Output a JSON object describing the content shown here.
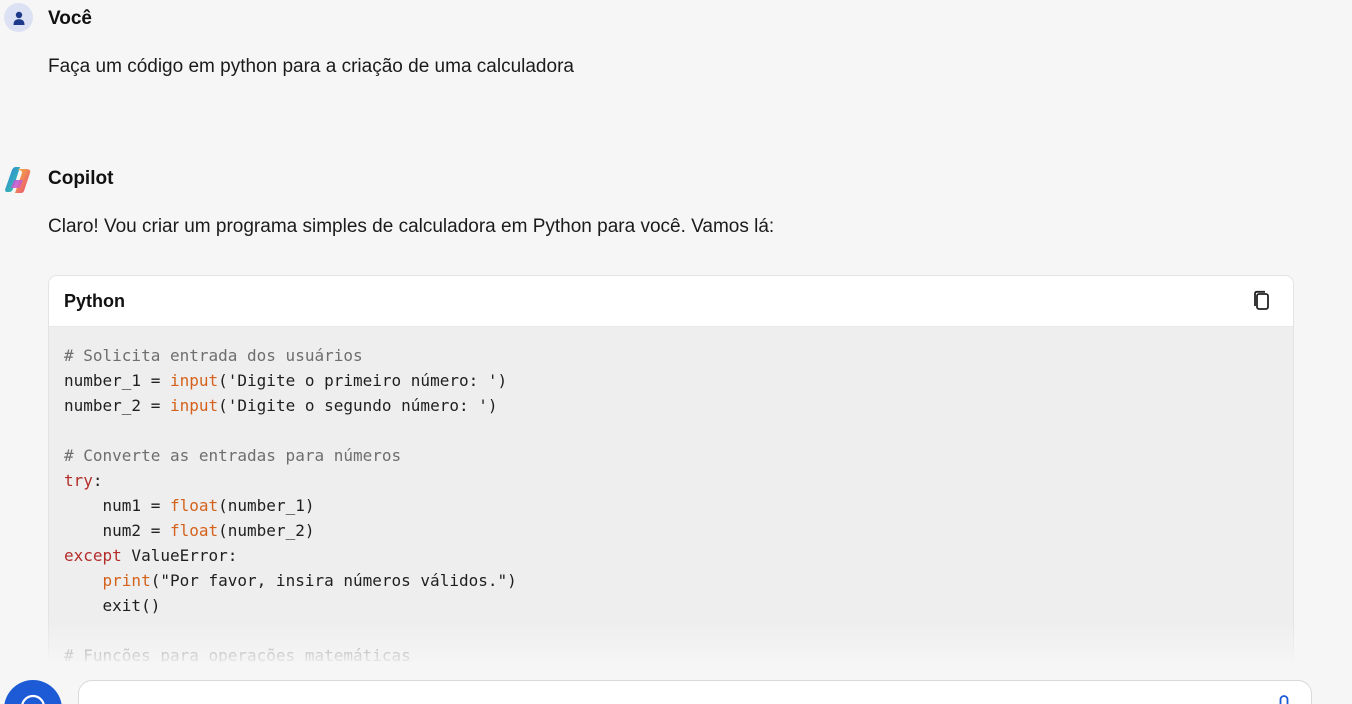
{
  "user_message": {
    "author": "Você",
    "text": "Faça um código em python para a criação de uma calculadora"
  },
  "copilot_message": {
    "author": "Copilot",
    "text": "Claro! Vou criar um programa simples de calculadora em Python para você. Vamos lá:"
  },
  "code_block": {
    "language": "Python",
    "lines": [
      {
        "segments": [
          {
            "t": "# Solicita entrada dos usuários",
            "c": "cm"
          }
        ]
      },
      {
        "segments": [
          {
            "t": "number_1 = ",
            "c": ""
          },
          {
            "t": "input",
            "c": "bi"
          },
          {
            "t": "('Digite o primeiro número: ')",
            "c": ""
          }
        ]
      },
      {
        "segments": [
          {
            "t": "number_2 = ",
            "c": ""
          },
          {
            "t": "input",
            "c": "bi"
          },
          {
            "t": "('Digite o segundo número: ')",
            "c": ""
          }
        ]
      },
      {
        "segments": [
          {
            "t": "",
            "c": ""
          }
        ]
      },
      {
        "segments": [
          {
            "t": "# Converte as entradas para números",
            "c": "cm"
          }
        ]
      },
      {
        "segments": [
          {
            "t": "try",
            "c": "kw"
          },
          {
            "t": ":",
            "c": ""
          }
        ]
      },
      {
        "segments": [
          {
            "t": "    num1 = ",
            "c": ""
          },
          {
            "t": "float",
            "c": "bi"
          },
          {
            "t": "(number_1)",
            "c": ""
          }
        ]
      },
      {
        "segments": [
          {
            "t": "    num2 = ",
            "c": ""
          },
          {
            "t": "float",
            "c": "bi"
          },
          {
            "t": "(number_2)",
            "c": ""
          }
        ]
      },
      {
        "segments": [
          {
            "t": "except",
            "c": "kw"
          },
          {
            "t": " ValueError:",
            "c": ""
          }
        ]
      },
      {
        "segments": [
          {
            "t": "    ",
            "c": ""
          },
          {
            "t": "print",
            "c": "bi"
          },
          {
            "t": "(\"Por favor, insira números válidos.\")",
            "c": ""
          }
        ]
      },
      {
        "segments": [
          {
            "t": "    exit()",
            "c": ""
          }
        ]
      },
      {
        "segments": [
          {
            "t": "",
            "c": ""
          }
        ]
      },
      {
        "segments": [
          {
            "t": "# Funções para operações matemáticas",
            "c": "cm"
          }
        ]
      }
    ]
  },
  "composer": {
    "placeholder": ""
  },
  "icons": {
    "user_avatar": "person-icon",
    "copilot_avatar": "copilot-logo-icon",
    "copy": "copy-icon",
    "new_topic": "chat-bubble-icon",
    "mic": "microphone-icon"
  },
  "colors": {
    "accent": "#1d5bd6",
    "comment": "#6e6e6e",
    "builtin": "#d5621c",
    "keyword": "#b32d2a"
  }
}
